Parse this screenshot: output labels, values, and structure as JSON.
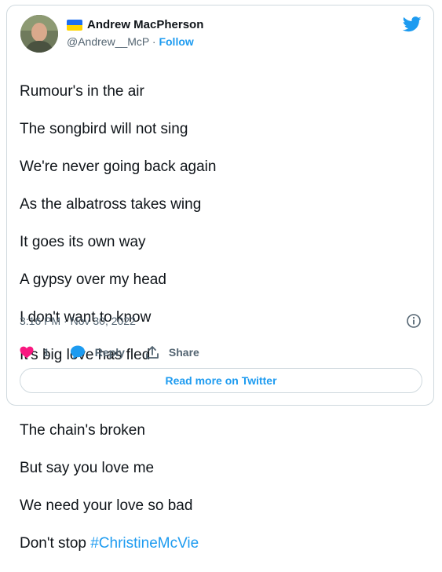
{
  "author": {
    "name": "Andrew MacPherson",
    "handle": "@Andrew__McP",
    "separator": "·",
    "follow_label": "Follow"
  },
  "tweet": {
    "lines": [
      "Rumour's in the air",
      "The songbird will not sing",
      "We're never going back again",
      "As the albatross takes wing",
      "It goes its own way",
      "A gypsy over my head",
      "I don't want to know",
      "It's big love has fled",
      "",
      "The chain's broken",
      "But say you love me",
      "We need your love so bad"
    ],
    "last_line_prefix": "Don't stop ",
    "hashtag": "#ChristineMcVie",
    "timestamp": "3:16 PM · Nov 30, 2022"
  },
  "actions": {
    "like_count": "1",
    "reply_label": "Reply",
    "share_label": "Share"
  },
  "read_more_label": "Read more on Twitter",
  "colors": {
    "accent": "#1d9bf0",
    "like": "#f91880",
    "text": "#0f1419",
    "muted": "#536471",
    "border": "#cfd9de"
  }
}
